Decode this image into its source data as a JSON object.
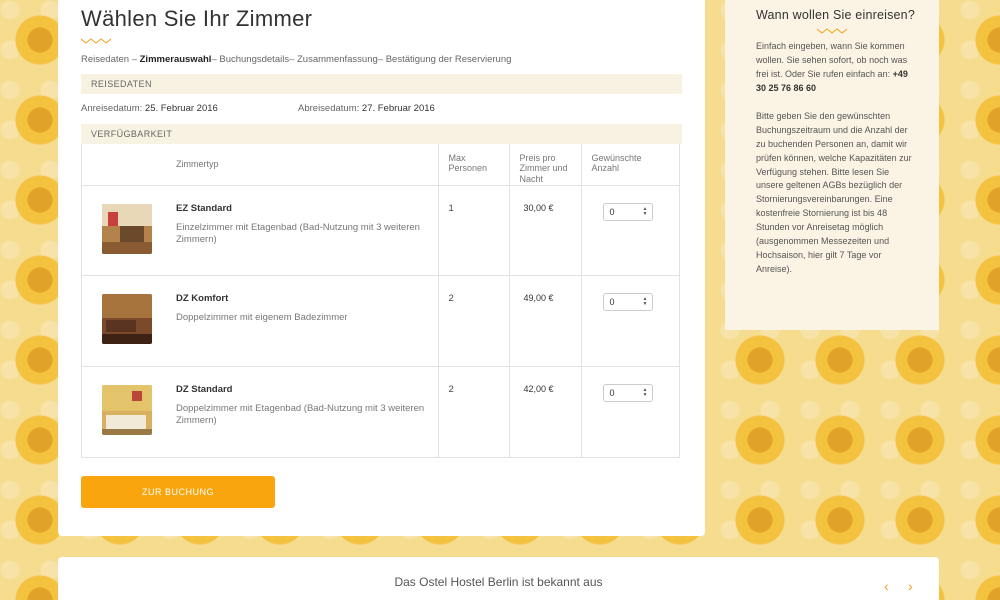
{
  "main": {
    "title": "Wählen Sie Ihr Zimmer",
    "steps": {
      "step1": "Reisedaten – ",
      "step2": "Zimmerauswahl",
      "step3": "– Buchungsdetails– Zusammenfassung– Bestätigung der Reservierung"
    },
    "travel_section": "Reisedaten",
    "arrival_label": "Anreisedatum:",
    "arrival_value": "25. Februar 2016",
    "departure_label": "Abreisedatum:",
    "departure_value": "27. Februar 2016",
    "availability_section": "Verfügbarkeit",
    "columns": {
      "room_type": "Zimmertyp",
      "max_persons": "Max Personen",
      "price": "Preis pro Zimmer und Nacht",
      "desired_count": "Gewünschte Anzahl"
    },
    "rooms": [
      {
        "name": "EZ Standard",
        "description": "Einzelzimmer mit Etagenbad (Bad-Nutzung mit 3 weiteren Zimmern)",
        "max": "1",
        "price": "30,00 €",
        "qty": "0"
      },
      {
        "name": "DZ Komfort",
        "description": "Doppelzimmer mit eigenem Badezimmer",
        "max": "2",
        "price": "49,00 €",
        "qty": "0"
      },
      {
        "name": "DZ Standard",
        "description": "Doppelzimmer mit Etagenbad (Bad-Nutzung mit 3 weiteren Zimmern)",
        "max": "2",
        "price": "42,00 €",
        "qty": "0"
      }
    ],
    "book_button": "ZUR BUCHUNG"
  },
  "sidebar": {
    "title": "Wann wollen Sie einreisen?",
    "intro": "Einfach eingeben, wann Sie kommen wollen. Sie sehen sofort, ob noch was frei ist. Oder Sie rufen einfach an: ",
    "phone": "+49 30 25 76 86 60",
    "info": "Bitte geben Sie den gewünschten Buchungszeitraum und die Anzahl der zu buchenden Personen an, damit wir prüfen können, welche Kapazitäten zur Verfügung stehen. Bitte lesen Sie unsere geltenen AGBs bezüglich der Stornierungsvereinbarungen. Eine kostenfreie Stornierung ist bis 48 Stunden vor Anreisetag möglich (ausgenommen Messezeiten und Hochsaison, hier gilt 7 Tage vor Anreise)."
  },
  "footer": {
    "title": "Das Ostel Hostel Berlin ist bekannt aus",
    "prev": "‹",
    "next": "›"
  },
  "colors": {
    "accent": "#f9a50e",
    "section_bg": "#f8f2e2",
    "sidebar_bg": "#fbf4e4"
  },
  "icons": {
    "stepper": "stepper-arrows-icon",
    "zigzag": "zigzag-divider-icon"
  }
}
